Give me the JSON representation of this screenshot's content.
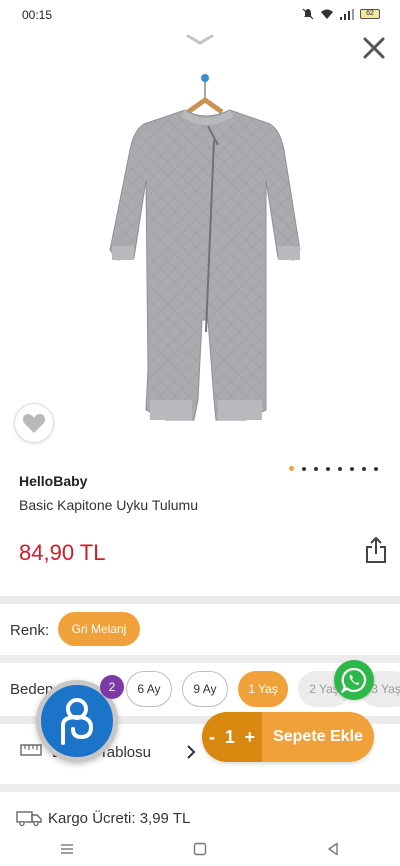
{
  "status_bar": {
    "time": "00:15",
    "battery": "62"
  },
  "product": {
    "brand": "HelloBaby",
    "name": "Basic Kapitone Uyku Tulumu",
    "price": "84,90 TL",
    "image_count": 8,
    "active_image": 1
  },
  "color": {
    "label": "Renk:",
    "selected": "Gri Melanj"
  },
  "size": {
    "label": "Beden",
    "options": [
      {
        "label": "6 Ay",
        "state": "available"
      },
      {
        "label": "9 Ay",
        "state": "available"
      },
      {
        "label": "1 Yaş",
        "state": "selected"
      },
      {
        "label": "2 Yaş",
        "state": "disabled"
      },
      {
        "label": "3 Yaş",
        "state": "disabled"
      }
    ]
  },
  "size_table": {
    "label": "Beden Tablosu"
  },
  "shipping": {
    "text": "Kargo Ücreti: 3,99 TL"
  },
  "chat": {
    "badge_count": "2"
  },
  "cart": {
    "minus": "-",
    "quantity": "1",
    "plus": "+",
    "label": "Sepete Ekle"
  },
  "colors": {
    "accent": "#f0a13a",
    "accent_dark": "#d8870f",
    "price": "#d31a2a",
    "whatsapp": "#2fb84a",
    "chat_fab": "#1b74c7",
    "badge": "#7b3aa6"
  }
}
